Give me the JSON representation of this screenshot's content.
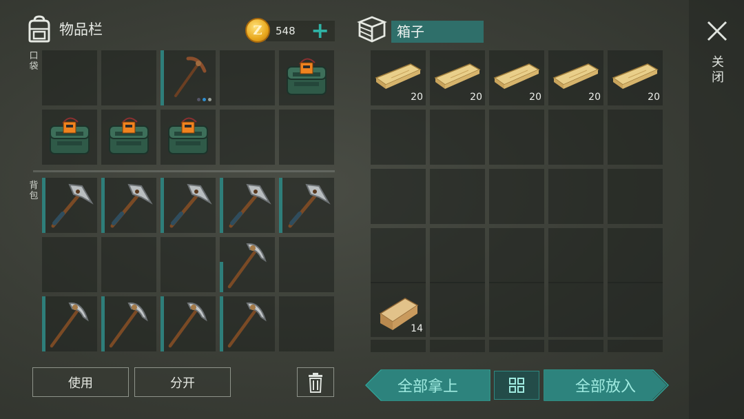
{
  "header": {
    "inventory_title": "物品栏",
    "coins": "548",
    "add_coins_label": "+",
    "box_title": "箱子",
    "close_label": "关闭"
  },
  "sections": {
    "pocket_label": "口袋",
    "backpack_label": "背包"
  },
  "pocket": [
    {
      "item": null
    },
    {
      "item": null
    },
    {
      "item": "pickaxe-icon",
      "tealbar": true,
      "dots": true
    },
    {
      "item": null
    },
    {
      "item": "c4-explosive-icon"
    },
    {
      "item": "c4-explosive-icon"
    },
    {
      "item": "c4-explosive-icon"
    },
    {
      "item": "c4-explosive-icon"
    },
    {
      "item": null
    },
    {
      "item": null
    }
  ],
  "backpack": [
    {
      "item": "hatchet-icon"
    },
    {
      "item": "hatchet-icon"
    },
    {
      "item": "hatchet-icon"
    },
    {
      "item": "hatchet-icon"
    },
    {
      "item": "hatchet-icon"
    },
    {
      "item": null
    },
    {
      "item": null
    },
    {
      "item": null
    },
    {
      "item": "stone-pickaxe-icon"
    },
    {
      "item": null
    },
    {
      "item": "stone-pickaxe-icon"
    },
    {
      "item": "stone-pickaxe-icon"
    },
    {
      "item": "stone-pickaxe-icon"
    },
    {
      "item": "stone-pickaxe-icon"
    },
    {
      "item": null
    }
  ],
  "box": {
    "slots": [
      {
        "item": "wood-plank-icon",
        "count": "20"
      },
      {
        "item": "wood-plank-icon",
        "count": "20"
      },
      {
        "item": "wood-plank-icon",
        "count": "20"
      },
      {
        "item": "wood-plank-icon",
        "count": "20"
      },
      {
        "item": "wood-plank-icon",
        "count": "20"
      },
      {
        "item": null
      },
      {
        "item": null
      },
      {
        "item": null
      },
      {
        "item": null
      },
      {
        "item": null
      },
      {
        "item": null
      },
      {
        "item": null
      },
      {
        "item": null
      },
      {
        "item": null
      },
      {
        "item": null
      },
      {
        "item": null
      },
      {
        "item": null
      },
      {
        "item": null
      },
      {
        "item": null
      },
      {
        "item": null
      },
      {
        "item": "log-icon",
        "count": "14"
      },
      {
        "item": null
      },
      {
        "item": null
      },
      {
        "item": null
      },
      {
        "item": null
      }
    ]
  },
  "buttons": {
    "use": "使用",
    "split": "分开",
    "take_all": "全部拿上",
    "put_all": "全部放入"
  },
  "colors": {
    "accent": "#2d837d",
    "accent_text": "#9feae0",
    "coin": "#e8a81d"
  }
}
